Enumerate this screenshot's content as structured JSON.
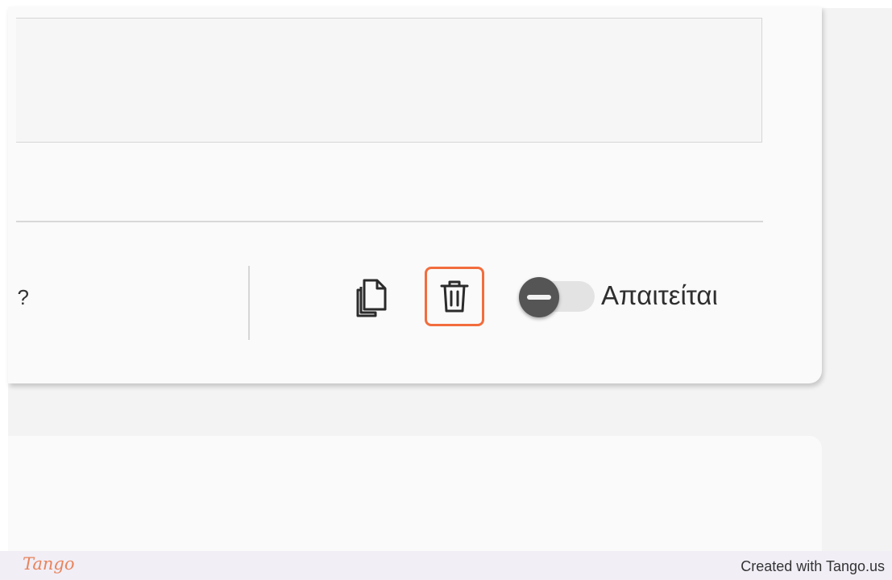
{
  "form": {
    "partial_question_text": "?",
    "copy_tooltip": "copy",
    "delete_tooltip": "delete",
    "required_label": "Απαιτείται",
    "required_toggle_on": false
  },
  "footer": {
    "logo_text": "Tango",
    "credit_text": "Created with Tango.us"
  },
  "colors": {
    "highlight": "#f26d3d",
    "knob": "#555555",
    "brand": "#e8845c"
  }
}
